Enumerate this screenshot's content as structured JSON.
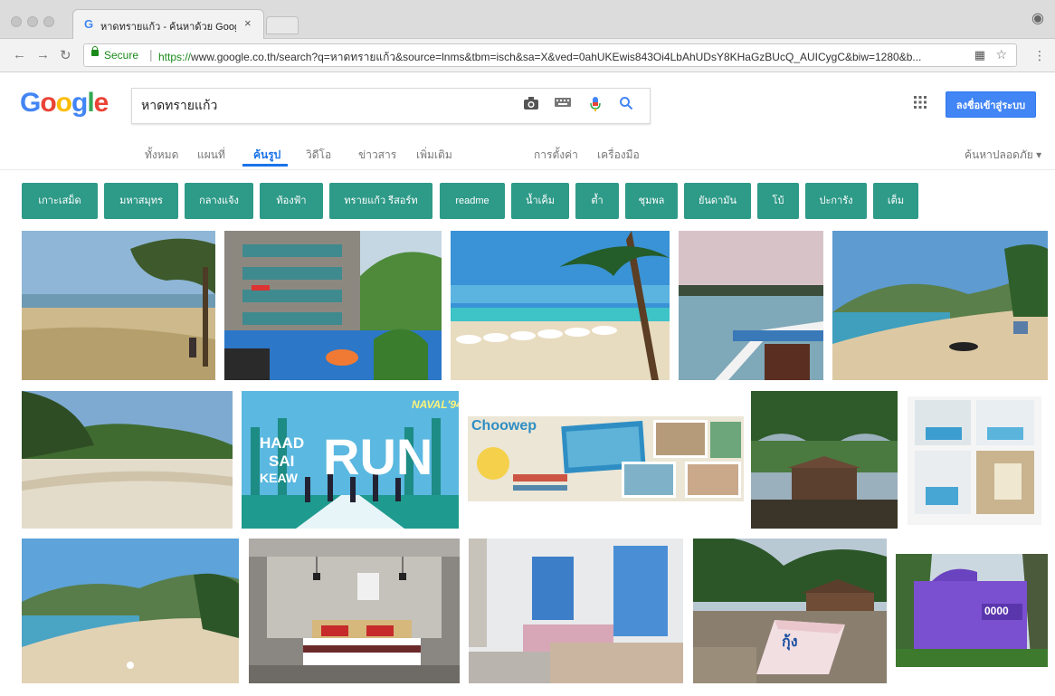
{
  "browser": {
    "tab_title": "หาดทรายแก้ว - ค้นหาด้วย Google",
    "tab_close": "×",
    "secure_label": "Secure",
    "url_scheme": "https://",
    "url_rest": "www.google.co.th/search?q=หาดทรายแก้ว&source=lnms&tbm=isch&sa=X&ved=0ahUKEwis843Oi4LbAhUDsY8KHaGzBUcQ_AUICygC&biw=1280&b..."
  },
  "logo": {
    "letters": [
      "G",
      "o",
      "o",
      "g",
      "l",
      "e"
    ],
    "colors": [
      "#4285f4",
      "#ea4335",
      "#fbbc05",
      "#4285f4",
      "#34a853",
      "#ea4335"
    ]
  },
  "search": {
    "value": "หาดทรายแก้ว"
  },
  "header": {
    "signin_label": "ลงชื่อเข้าสู่ระบบ"
  },
  "nav": {
    "tabs": [
      {
        "label": "ทั้งหมด"
      },
      {
        "label": "แผนที่"
      },
      {
        "label": "ค้นรูป"
      },
      {
        "label": "วิดีโอ"
      },
      {
        "label": "ข่าวสาร"
      },
      {
        "label": "เพิ่มเติม"
      },
      {
        "label": "การตั้งค่า"
      },
      {
        "label": "เครื่องมือ"
      }
    ],
    "active": "ค้นรูป",
    "safesearch": "ค้นหาปลอดภัย ▾"
  },
  "chips": [
    "เกาะเสม็ด",
    "มหาสมุทร",
    "กลางแจ้ง",
    "ท้องฟ้า",
    "ทรายแก้ว รีสอร์ท",
    "readme",
    "น้ำเค็ม",
    "ต้ำ",
    "ชุมพล",
    "ยันดามัน",
    "โบ้",
    "ปะการัง",
    "เต็ม"
  ],
  "image_text": {
    "run_title_1": "HAAD",
    "run_title_2": "SAI",
    "run_title_3": "KEAW",
    "run_big": "RUN",
    "run_naval": "NAVAL'94",
    "choowep": "Choowep",
    "boat_label": "กุ้ง",
    "house_sign": "0000"
  },
  "colors": {
    "accent": "#1a73e8",
    "chip": "#2e9a88",
    "signin": "#4285f4"
  }
}
